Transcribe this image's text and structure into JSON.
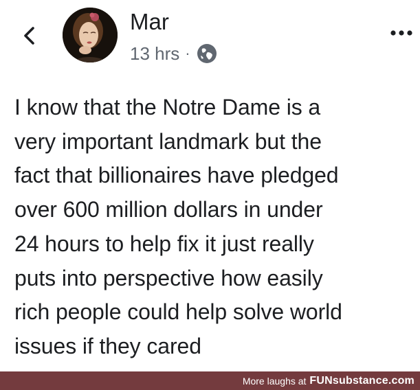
{
  "post": {
    "author": "Mar",
    "timestamp": "13 hrs",
    "separator": "·",
    "privacy_icon": "globe-icon",
    "text": "I know that the Notre Dame is a\nvery important landmark but the\nfact that billionaires have pledged\nover 600 million dollars in under\n24 hours to help fix it just really\nputs into perspective how easily\nrich people could help solve world\nissues if they cared"
  },
  "icons": {
    "back": "chevron-left-icon",
    "more": "ellipsis-icon",
    "avatar": "avatar"
  },
  "footer": {
    "caption": "More laughs at",
    "site": "FUNsubstance.com"
  },
  "colors": {
    "text": "#1c1e21",
    "meta": "#606770",
    "footer_bg": "#743b3e"
  }
}
